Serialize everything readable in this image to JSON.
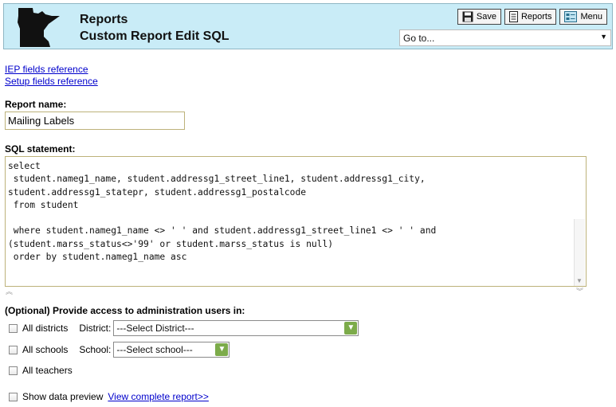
{
  "header": {
    "title": "Reports",
    "subtitle": "Custom Report Edit SQL",
    "logo_icon": "minnesota-state-icon",
    "buttons": {
      "save": "Save",
      "reports": "Reports",
      "menu": "Menu"
    },
    "goto": {
      "value": "Go to..."
    }
  },
  "links": {
    "iep_fields": "IEP fields reference",
    "setup_fields": "Setup fields reference"
  },
  "form": {
    "report_name_label": "Report name:",
    "report_name_value": "Mailing Labels",
    "sql_label": "SQL statement:",
    "sql_value": "select\n student.nameg1_name, student.addressg1_street_line1, student.addressg1_city,\nstudent.addressg1_statepr, student.addressg1_postalcode\n from student\n\n where student.nameg1_name <> ' ' and student.addressg1_street_line1 <> ' ' and\n(student.marss_status<>'99' or student.marss_status is null)\n order by student.nameg1_name asc",
    "access_label": "(Optional) Provide access to administration users in:",
    "all_districts": "All districts",
    "district_label": "District:",
    "district_select": "---Select District---",
    "all_schools": "All schools",
    "school_label": "School:",
    "school_select": "---Select school---",
    "all_teachers": "All teachers",
    "show_preview": "Show data preview",
    "view_report": "View complete report>>"
  },
  "colors": {
    "header_bg": "#c9ecf7",
    "link": "#0000cc",
    "dropdown_button": "#7cab4a"
  }
}
